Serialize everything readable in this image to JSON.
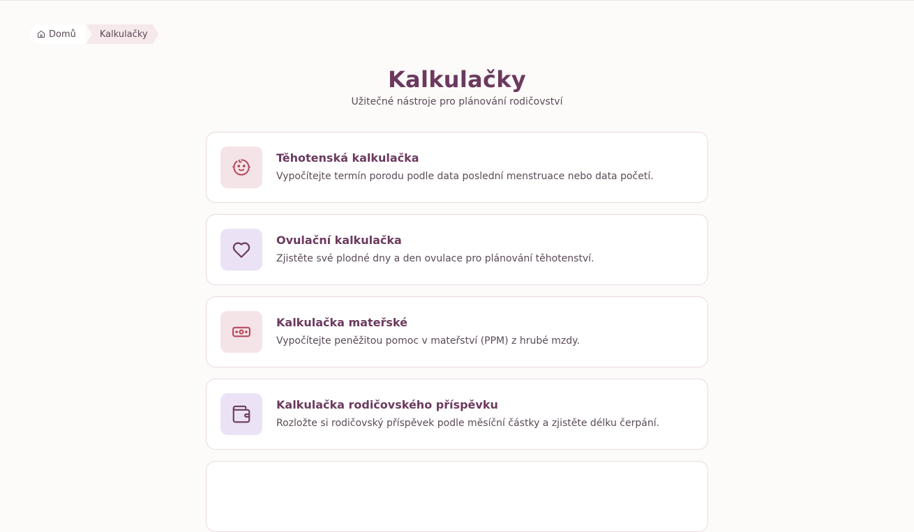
{
  "breadcrumb": {
    "home_label": "Domů",
    "current_label": "Kalkulačky"
  },
  "header": {
    "title": "Kalkulačky",
    "subtitle": "Užitečné nástroje pro plánování rodičovství"
  },
  "cards": [
    {
      "title": "Těhotenská kalkulačka",
      "description": "Vypočítejte termín porodu podle data poslední menstruace nebo data početí.",
      "icon": "baby-face-icon",
      "icon_bg": "#f5e4e7",
      "icon_color": "#b5485f"
    },
    {
      "title": "Ovulační kalkulačka",
      "description": "Zjistěte své plodné dny a den ovulace pro plánování těhotenství.",
      "icon": "heart-icon",
      "icon_bg": "#ebe3f5",
      "icon_color": "#6b3a5e"
    },
    {
      "title": "Kalkulačka mateřské",
      "description": "Vypočítejte peněžitou pomoc v mateřství (PPM) z hrubé mzdy.",
      "icon": "banknote-icon",
      "icon_bg": "#f5e4e7",
      "icon_color": "#b5485f"
    },
    {
      "title": "Kalkulačka rodičovského příspěvku",
      "description": "Rozložte si rodičovský příspěvek podle měsíční částky a zjistěte délku čerpání.",
      "icon": "wallet-icon",
      "icon_bg": "#ebe3f5",
      "icon_color": "#6b3a5e"
    }
  ]
}
